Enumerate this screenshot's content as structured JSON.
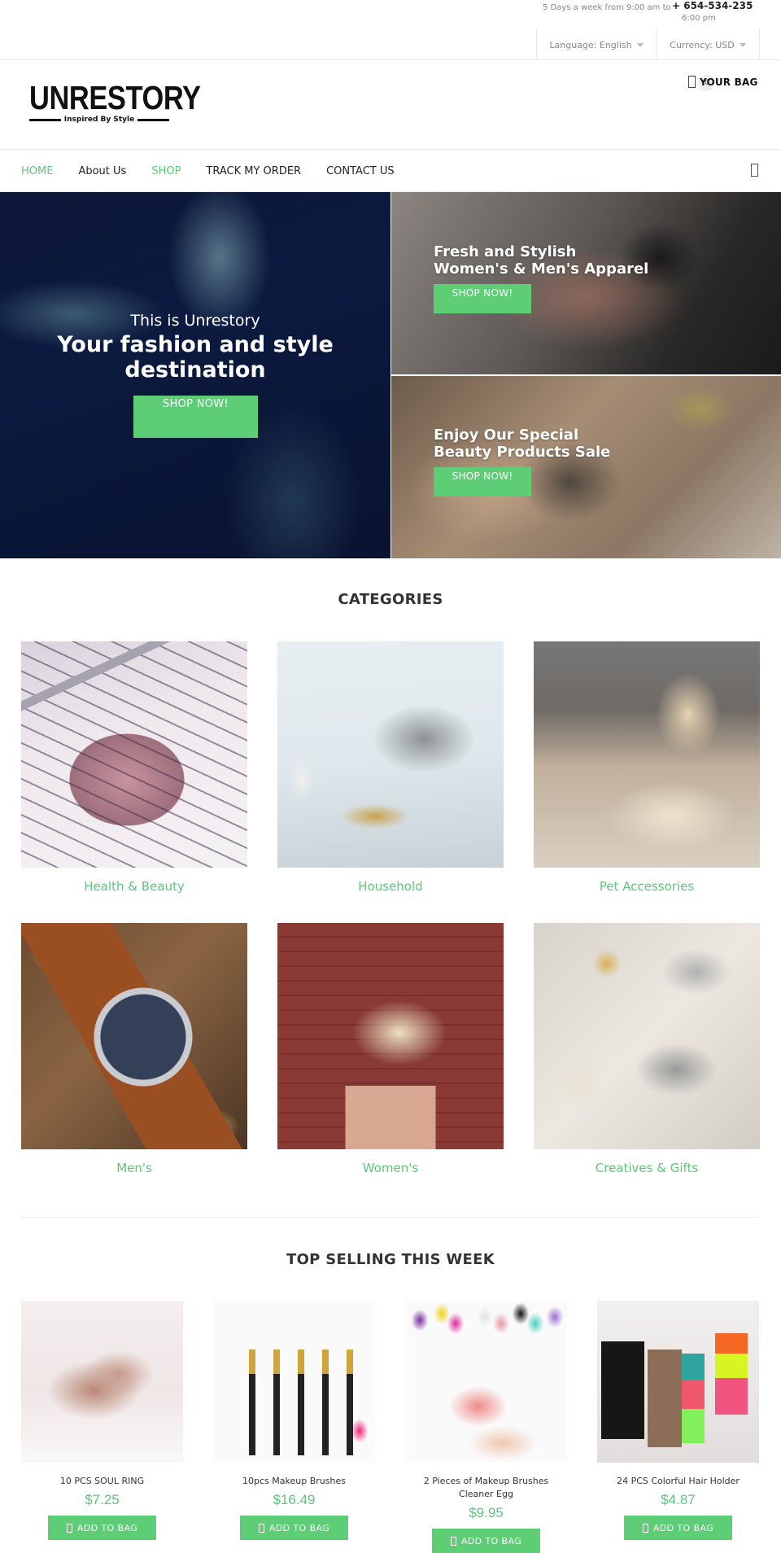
{
  "topbar": {
    "hours_line1": "5 Days a week from 9:00 am to",
    "hours_line2": "6:00 pm",
    "phone": "+ 654-534-235",
    "language": "Language: English",
    "currency": "Currency: USD"
  },
  "header": {
    "logo_word": "UNRESTORY",
    "logo_tagline": "Inspired By Style",
    "bag_count": "0",
    "bag_label": "YOUR BAG"
  },
  "nav": {
    "items": [
      {
        "label": "HOME",
        "active": true
      },
      {
        "label": "About Us",
        "active": false
      },
      {
        "label": "SHOP",
        "active": true
      },
      {
        "label": "TRACK MY ORDER",
        "active": false
      },
      {
        "label": "CONTACT US",
        "active": false
      }
    ]
  },
  "hero": {
    "main": {
      "pre": "This is Unrestory",
      "title": "Your fashion and style destination",
      "button": "SHOP NOW!"
    },
    "tiles": [
      {
        "title_line1": "Fresh and Stylish",
        "title_line2": "Women's & Men's Apparel",
        "button": "SHOP NOW!"
      },
      {
        "title_line1": "Enjoy Our Special",
        "title_line2": "Beauty Products Sale",
        "button": "SHOP NOW!"
      }
    ]
  },
  "categories": {
    "title": "CATEGORIES",
    "items": [
      {
        "label": "Health & Beauty"
      },
      {
        "label": "Household"
      },
      {
        "label": "Pet Accessories"
      },
      {
        "label": "Men's"
      },
      {
        "label": "Women's"
      },
      {
        "label": "Creatives & Gifts"
      }
    ]
  },
  "top_selling": {
    "title": "TOP SELLING THIS WEEK",
    "add_button": "ADD TO BAG",
    "products": [
      {
        "name": "10 PCS SOUL RING",
        "price": "$7.25"
      },
      {
        "name": "10pcs Makeup Brushes",
        "price": "$16.49"
      },
      {
        "name": "2 Pieces of Makeup Brushes Cleaner Egg",
        "price": "$9.95"
      },
      {
        "name": "24 PCS Colorful Hair Holder",
        "price": "$4.87"
      }
    ]
  },
  "colors": {
    "accent_green": "#5dcd76",
    "text_dark": "#222222",
    "text_muted": "#888888"
  }
}
